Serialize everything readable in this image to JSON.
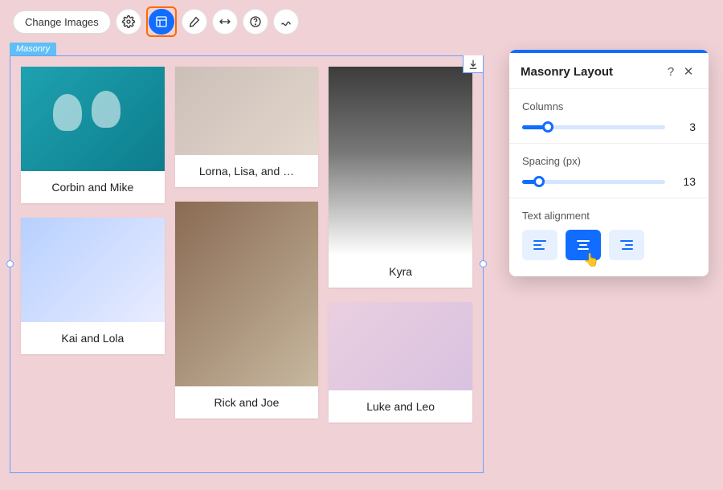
{
  "toolbar": {
    "change_images_label": "Change Images",
    "icons": {
      "settings": "gear-icon",
      "layout": "layout-icon",
      "design": "brush-icon",
      "stretch": "stretch-icon",
      "help": "help-icon",
      "animation": "animation-icon"
    }
  },
  "widget_tag": "Masonry",
  "gallery": {
    "columns": 3,
    "spacing_px": 13,
    "items": [
      {
        "caption": "Corbin and Mike"
      },
      {
        "caption": "Kai and Lola"
      },
      {
        "caption": "Lorna, Lisa, and …"
      },
      {
        "caption": "Rick and Joe"
      },
      {
        "caption": "Kyra"
      },
      {
        "caption": "Luke and Leo"
      }
    ]
  },
  "panel": {
    "title": "Masonry Layout",
    "help_icon": "?",
    "close_icon": "✕",
    "sections": {
      "columns": {
        "label": "Columns",
        "value": 3,
        "fill_pct": 18
      },
      "spacing": {
        "label": "Spacing (px)",
        "value": 13,
        "fill_pct": 12
      },
      "alignment": {
        "label": "Text alignment",
        "selected": "center"
      }
    }
  }
}
